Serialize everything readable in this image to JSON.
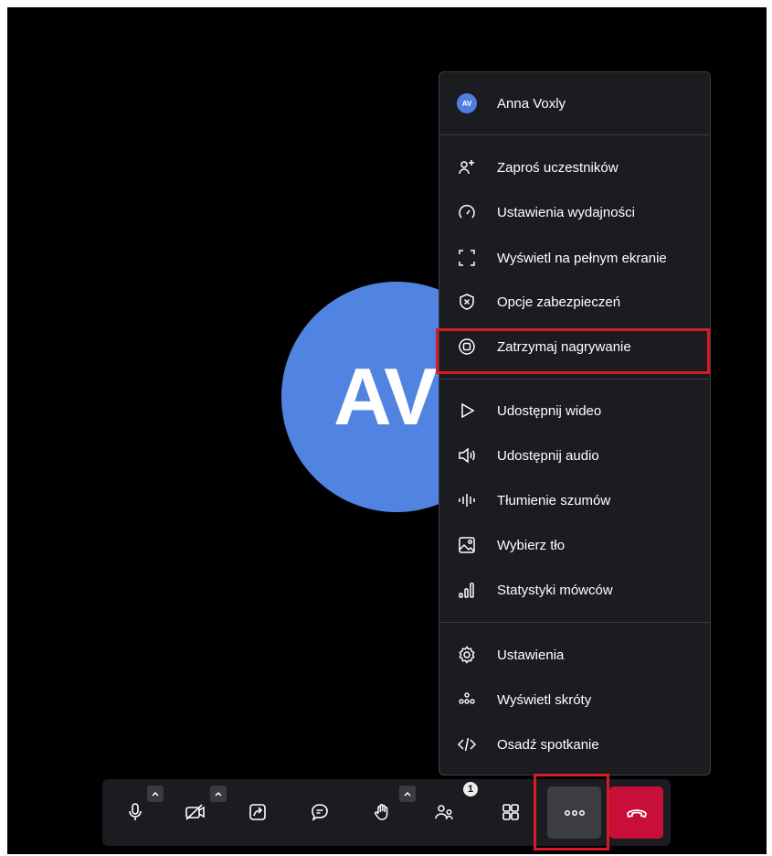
{
  "participant": {
    "initials": "AV"
  },
  "menu": {
    "user": {
      "initials": "AV",
      "name": "Anna Voxly"
    },
    "group1": [
      {
        "icon": "invite-participants-icon",
        "label": "Zaproś uczestników"
      },
      {
        "icon": "performance-gauge-icon",
        "label": "Ustawienia wydajności"
      },
      {
        "icon": "fullscreen-icon",
        "label": "Wyświetl na pełnym ekranie"
      },
      {
        "icon": "shield-icon",
        "label": "Opcje zabezpieczeń"
      },
      {
        "icon": "stop-recording-icon",
        "label": "Zatrzymaj nagrywanie"
      }
    ],
    "group2": [
      {
        "icon": "play-icon",
        "label": "Udostępnij wideo"
      },
      {
        "icon": "speaker-icon",
        "label": "Udostępnij audio"
      },
      {
        "icon": "noise-suppression-icon",
        "label": "Tłumienie szumów"
      },
      {
        "icon": "background-image-icon",
        "label": "Wybierz tło"
      },
      {
        "icon": "speaker-stats-icon",
        "label": "Statystyki mówców"
      }
    ],
    "group3": [
      {
        "icon": "gear-icon",
        "label": "Ustawienia"
      },
      {
        "icon": "shortcuts-icon",
        "label": "Wyświetl skróty"
      },
      {
        "icon": "embed-code-icon",
        "label": "Osadź spotkanie"
      }
    ]
  },
  "toolbar": {
    "participants_count": "1",
    "buttons": [
      "microphone-icon",
      "camera-off-icon",
      "screen-share-icon",
      "chat-icon",
      "raise-hand-icon",
      "participants-icon",
      "tile-view-icon",
      "more-icon",
      "hangup-icon"
    ]
  },
  "colors": {
    "accent_avatar": "#5183e0",
    "highlight": "#d61a27",
    "hangup": "#c80f3a",
    "menu_bg": "#1b1c1f"
  }
}
